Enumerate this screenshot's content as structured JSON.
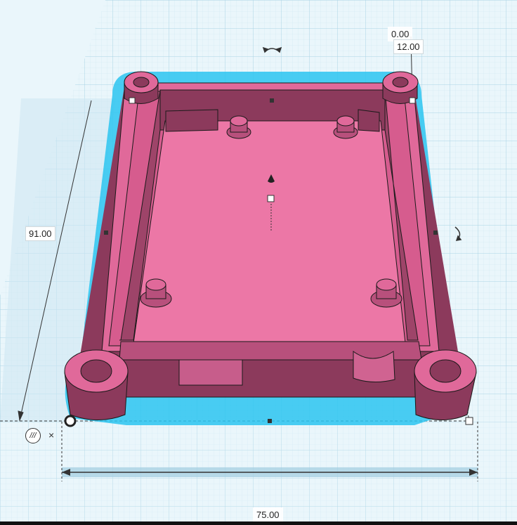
{
  "dimensions": {
    "height_top": "0.00",
    "height_value": "12.00",
    "length_value": "91.00",
    "width_value": "75.00"
  },
  "controls": {
    "snap_icon": "snap-grid-icon",
    "close_icon": "close-icon",
    "snap_glyph": "///",
    "close_glyph": "×"
  },
  "colors": {
    "shape_fill": "#e0699a",
    "shape_dark": "#8c3a5c",
    "shape_mid": "#c0507e",
    "selection_outline": "#2cc4f0",
    "grid_background": "#eaf6fb",
    "grid_line": "#b8dceb"
  }
}
